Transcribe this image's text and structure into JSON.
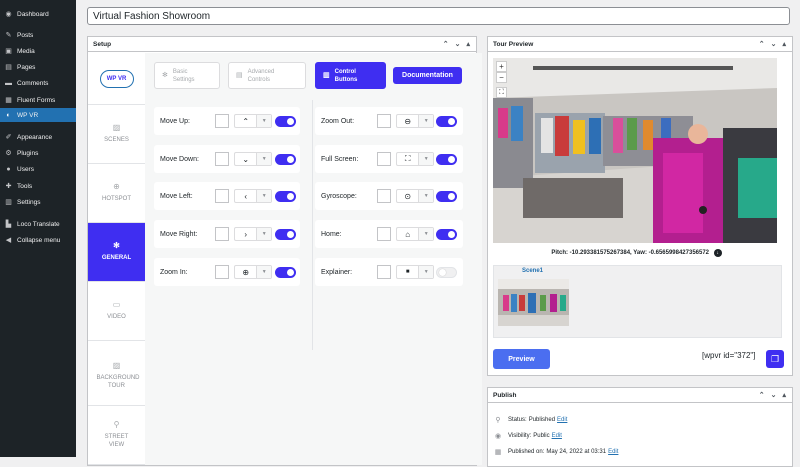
{
  "sidebar": {
    "items": [
      {
        "label": "Dashboard",
        "icon": "dashboard-icon",
        "glyph": "◉"
      },
      {
        "label": "Posts",
        "icon": "pin-icon",
        "glyph": "✎"
      },
      {
        "label": "Media",
        "icon": "media-icon",
        "glyph": "▣"
      },
      {
        "label": "Pages",
        "icon": "pages-icon",
        "glyph": "▤"
      },
      {
        "label": "Comments",
        "icon": "comments-icon",
        "glyph": "▬"
      },
      {
        "label": "Fluent Forms",
        "icon": "fluent-forms-icon",
        "glyph": "▦"
      },
      {
        "label": "WP VR",
        "icon": "wpvr-icon",
        "glyph": "◐"
      },
      {
        "label": "Appearance",
        "icon": "brush-icon",
        "glyph": "✐"
      },
      {
        "label": "Plugins",
        "icon": "plugin-icon",
        "glyph": "⚙"
      },
      {
        "label": "Users",
        "icon": "users-icon",
        "glyph": "●"
      },
      {
        "label": "Tools",
        "icon": "tools-icon",
        "glyph": "✚"
      },
      {
        "label": "Settings",
        "icon": "settings-icon",
        "glyph": "▥"
      },
      {
        "label": "Loco Translate",
        "icon": "translate-icon",
        "glyph": "▙"
      },
      {
        "label": "Collapse menu",
        "icon": "collapse-icon",
        "glyph": "◀"
      }
    ]
  },
  "post_title": "Virtual Fashion Showroom",
  "setup": {
    "title": "Setup",
    "logo_text": "WP VR",
    "tabs": [
      {
        "label": "SCENES",
        "icon": "image-icon",
        "glyph": "▨"
      },
      {
        "label": "HOTSPOT",
        "icon": "hotspot-icon",
        "glyph": "⊕"
      },
      {
        "label": "GENERAL",
        "icon": "gear-icon",
        "glyph": "✻"
      },
      {
        "label": "VIDEO",
        "icon": "video-icon",
        "glyph": "▭"
      },
      {
        "label": "BACKGROUND TOUR",
        "icon": "background-tour-icon",
        "glyph": "▨"
      },
      {
        "label": "STREET VIEW",
        "icon": "street-view-icon",
        "glyph": "⚲"
      }
    ],
    "sub_tabs": {
      "basic": "Basic Settings",
      "advanced": "Advanced Controls",
      "control": "Control Buttons"
    },
    "documentation": "Documentation",
    "controls_left": [
      {
        "label": "Move Up:",
        "icon": "chevron-up-icon",
        "glyph": "⌃",
        "enabled": true
      },
      {
        "label": "Move Down:",
        "icon": "chevron-down-icon",
        "glyph": "⌄",
        "enabled": true
      },
      {
        "label": "Move Left:",
        "icon": "chevron-left-icon",
        "glyph": "‹",
        "enabled": true
      },
      {
        "label": "Move Right:",
        "icon": "chevron-right-icon",
        "glyph": "›",
        "enabled": true
      },
      {
        "label": "Zoom In:",
        "icon": "plus-circle-icon",
        "glyph": "⊕",
        "enabled": true
      }
    ],
    "controls_right": [
      {
        "label": "Zoom Out:",
        "icon": "minus-circle-icon",
        "glyph": "⊖",
        "enabled": true
      },
      {
        "label": "Full Screen:",
        "icon": "fullscreen-icon",
        "glyph": "⛶",
        "enabled": true
      },
      {
        "label": "Gyroscope:",
        "icon": "gyroscope-icon",
        "glyph": "⊙",
        "enabled": true
      },
      {
        "label": "Home:",
        "icon": "home-icon",
        "glyph": "⌂",
        "enabled": true
      },
      {
        "label": "Explainer:",
        "icon": "video-camera-icon",
        "glyph": "■",
        "enabled": false
      }
    ]
  },
  "tour_preview": {
    "title": "Tour Preview",
    "zoom_in": "+",
    "zoom_out": "−",
    "fullscreen": "⛶",
    "pitch_yaw": "Pitch: -10.293381575267384, Yaw: -0.6565998427356572",
    "scene_name": "Scene1",
    "preview_button": "Preview",
    "shortcode": "[wpvr id=\"372\"]"
  },
  "publish": {
    "title": "Publish",
    "status_label": "Status:",
    "status_value": "Published",
    "visibility_label": "Visibility:",
    "visibility_value": "Public",
    "published_label": "Published on:",
    "published_value": "May 24, 2022 at 03:31",
    "edit": "Edit"
  },
  "colors": {
    "accent": "#3f2ef1",
    "wp_sidebar": "#1d2327",
    "wp_blue": "#2271b1"
  }
}
